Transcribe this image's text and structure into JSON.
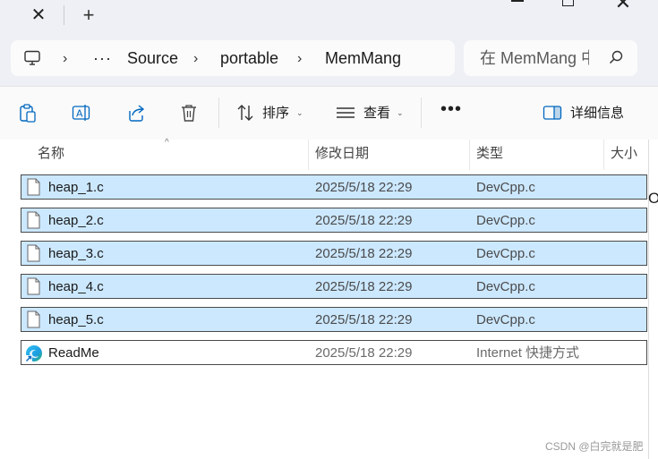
{
  "titlebar": {
    "close_tab_glyph": "✕",
    "new_tab_glyph": "+",
    "window_close_glyph": "✕"
  },
  "nav": {
    "ellipsis": "···",
    "crumbs": [
      "Source",
      "portable",
      "MemMang"
    ],
    "search_placeholder": "在 MemMang 中搜索"
  },
  "toolbar": {
    "sort_label": "排序",
    "view_label": "查看",
    "more_label": "•••",
    "details_label": "详细信息"
  },
  "columns": {
    "name": "名称",
    "modified": "修改日期",
    "type": "类型",
    "size": "大小"
  },
  "files": [
    {
      "name": "heap_1.c",
      "modified": "2025/5/18 22:29",
      "type": "DevCpp.c",
      "selected": true,
      "icon": "file-icon"
    },
    {
      "name": "heap_2.c",
      "modified": "2025/5/18 22:29",
      "type": "DevCpp.c",
      "selected": true,
      "icon": "file-icon"
    },
    {
      "name": "heap_3.c",
      "modified": "2025/5/18 22:29",
      "type": "DevCpp.c",
      "selected": true,
      "icon": "file-icon"
    },
    {
      "name": "heap_4.c",
      "modified": "2025/5/18 22:29",
      "type": "DevCpp.c",
      "selected": true,
      "icon": "file-icon"
    },
    {
      "name": "heap_5.c",
      "modified": "2025/5/18 22:29",
      "type": "DevCpp.c",
      "selected": true,
      "icon": "file-icon"
    },
    {
      "name": "ReadMe",
      "modified": "2025/5/18 22:29",
      "type": "Internet 快捷方式",
      "selected": false,
      "icon": "edge-shortcut-icon"
    }
  ],
  "edge_glyph": "O",
  "watermark": "CSDN @白完就是肥",
  "colors": {
    "selection": "#cce8ff",
    "chrome_bg": "#eef0f5",
    "accent": "#0067c0"
  }
}
